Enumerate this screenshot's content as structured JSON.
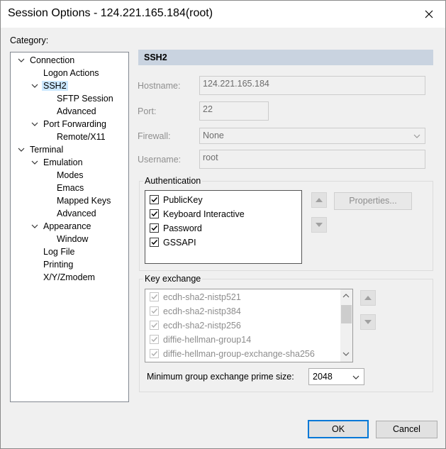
{
  "window": {
    "title": "Session Options - 124.221.165.184(root)"
  },
  "category_label": "Category:",
  "tree": [
    {
      "label": "Connection",
      "expanded": true
    },
    {
      "label": "Logon Actions"
    },
    {
      "label": "SSH2",
      "expanded": true,
      "selected": true
    },
    {
      "label": "SFTP Session"
    },
    {
      "label": "Advanced"
    },
    {
      "label": "Port Forwarding",
      "expanded": true
    },
    {
      "label": "Remote/X11"
    },
    {
      "label": "Terminal",
      "expanded": true
    },
    {
      "label": "Emulation",
      "expanded": true
    },
    {
      "label": "Modes"
    },
    {
      "label": "Emacs"
    },
    {
      "label": "Mapped Keys"
    },
    {
      "label": "Advanced"
    },
    {
      "label": "Appearance",
      "expanded": true
    },
    {
      "label": "Window"
    },
    {
      "label": "Log File"
    },
    {
      "label": "Printing"
    },
    {
      "label": "X/Y/Zmodem"
    }
  ],
  "section_title": "SSH2",
  "fields": {
    "hostname": {
      "label": "Hostname:",
      "value": "124.221.165.184"
    },
    "port": {
      "label": "Port:",
      "value": "22"
    },
    "firewall": {
      "label": "Firewall:",
      "value": "None"
    },
    "username": {
      "label": "Username:",
      "value": "root"
    }
  },
  "authentication": {
    "label": "Authentication",
    "items": [
      {
        "label": "PublicKey",
        "checked": true
      },
      {
        "label": "Keyboard Interactive",
        "checked": true
      },
      {
        "label": "Password",
        "checked": true
      },
      {
        "label": "GSSAPI",
        "checked": true
      }
    ],
    "properties_label": "Properties..."
  },
  "key_exchange": {
    "label": "Key exchange",
    "items": [
      {
        "label": "ecdh-sha2-nistp521",
        "checked": true
      },
      {
        "label": "ecdh-sha2-nistp384",
        "checked": true
      },
      {
        "label": "ecdh-sha2-nistp256",
        "checked": true
      },
      {
        "label": "diffie-hellman-group14",
        "checked": true
      },
      {
        "label": "diffie-hellman-group-exchange-sha256",
        "checked": true
      }
    ],
    "min_group_label": "Minimum group exchange prime size:",
    "min_group_value": "2048"
  },
  "buttons": {
    "ok": "OK",
    "cancel": "Cancel"
  },
  "colors": {
    "selection": "#cce8ff",
    "header": "#c9d3e0",
    "accent": "#0078d7"
  },
  "icons": {
    "close": "close-icon",
    "expand": "chevron-down-icon",
    "up": "arrow-up-icon",
    "down": "arrow-down-icon"
  }
}
